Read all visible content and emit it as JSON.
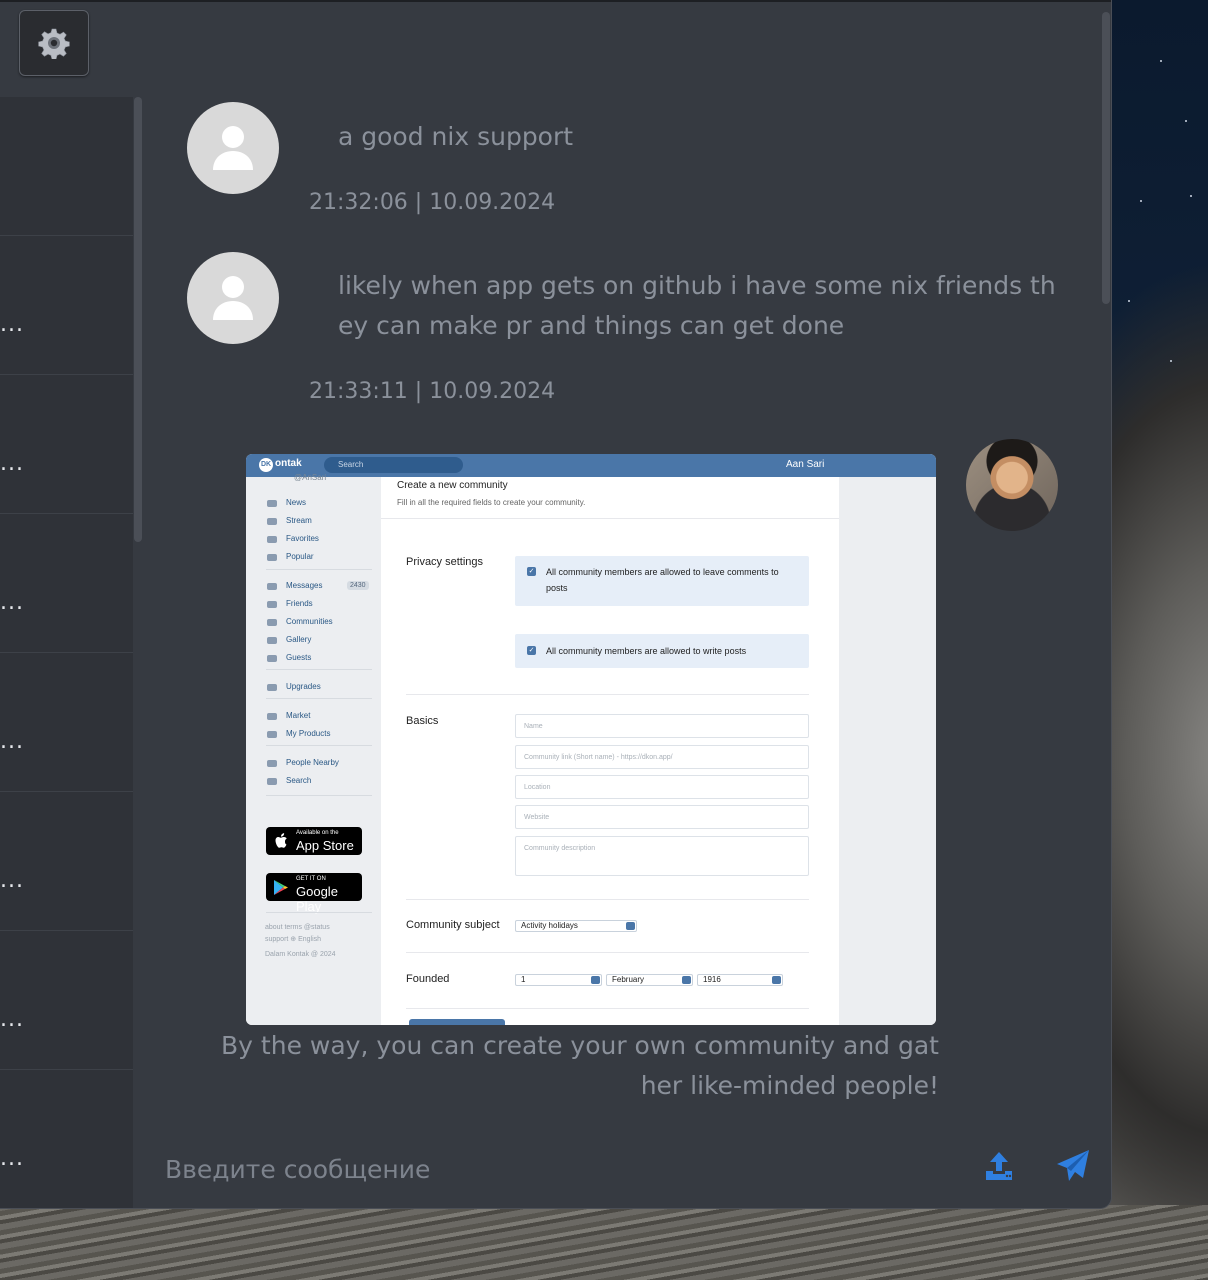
{
  "colors": {
    "accent": "#2f7fe0",
    "window_bg": "#363a41",
    "muted_text": "#8b919b"
  },
  "toolbar": {
    "settings_icon": "gear-icon"
  },
  "sidebar": {
    "items": [
      {
        "more": "..."
      },
      {
        "more": "..."
      },
      {
        "more": "..."
      },
      {
        "more": "..."
      },
      {
        "more": "..."
      },
      {
        "more": "..."
      },
      {
        "more": "..."
      },
      {
        "more": "..."
      }
    ]
  },
  "messages": [
    {
      "text": "a good nix support",
      "time": "21:32:06 | 10.09.2024",
      "avatar": "user-placeholder-icon"
    },
    {
      "text_line1": "likely when app gets on github i have some nix friends th",
      "text_line2": "ey can make pr and things can get done",
      "time": "21:33:11 | 10.09.2024",
      "avatar": "user-placeholder-icon"
    },
    {
      "caption_line1": "By the way, you can create your own community and gat",
      "caption_line2": "her like-minded people!",
      "avatar": "user-photo"
    }
  ],
  "screenshot": {
    "logo": "ontak",
    "logo_badge": "DK",
    "search_placeholder": "Search",
    "user_name": "Aan Sari",
    "profile_handle": "@AnSari",
    "nav": [
      "News",
      "Stream",
      "Favorites",
      "Popular",
      "Messages",
      "Friends",
      "Communities",
      "Gallery",
      "Guests",
      "Upgrades",
      "Market",
      "My Products",
      "People Nearby",
      "Search"
    ],
    "messages_badge": "2430",
    "app_store_small": "Available on the",
    "app_store_big": "App Store",
    "google_play_small": "GET IT ON",
    "google_play_big": "Google Play",
    "footer_links": "about   terms   @status",
    "footer_links2": "support   ⊕ English",
    "footer_copy": "Dalam Kontak @ 2024",
    "title": "Create a new community",
    "subtitle": "Fill in all the required fields to create your community.",
    "privacy_label": "Privacy settings",
    "check1": "All community members are allowed to leave comments to posts",
    "check2": "All community members are allowed to write posts",
    "basics_label": "Basics",
    "ph_name": "Name",
    "ph_link": "Community link (Short name) - https://dkon.app/",
    "ph_location": "Location",
    "ph_website": "Website",
    "ph_description": "Community description",
    "subject_label": "Community subject",
    "subject_value": "Activity holidays",
    "founded_label": "Founded",
    "founded_day": "1",
    "founded_month": "February",
    "founded_year": "1916"
  },
  "composer": {
    "placeholder": "Введите сообщение",
    "upload_icon": "upload-icon",
    "send_icon": "send-icon"
  }
}
